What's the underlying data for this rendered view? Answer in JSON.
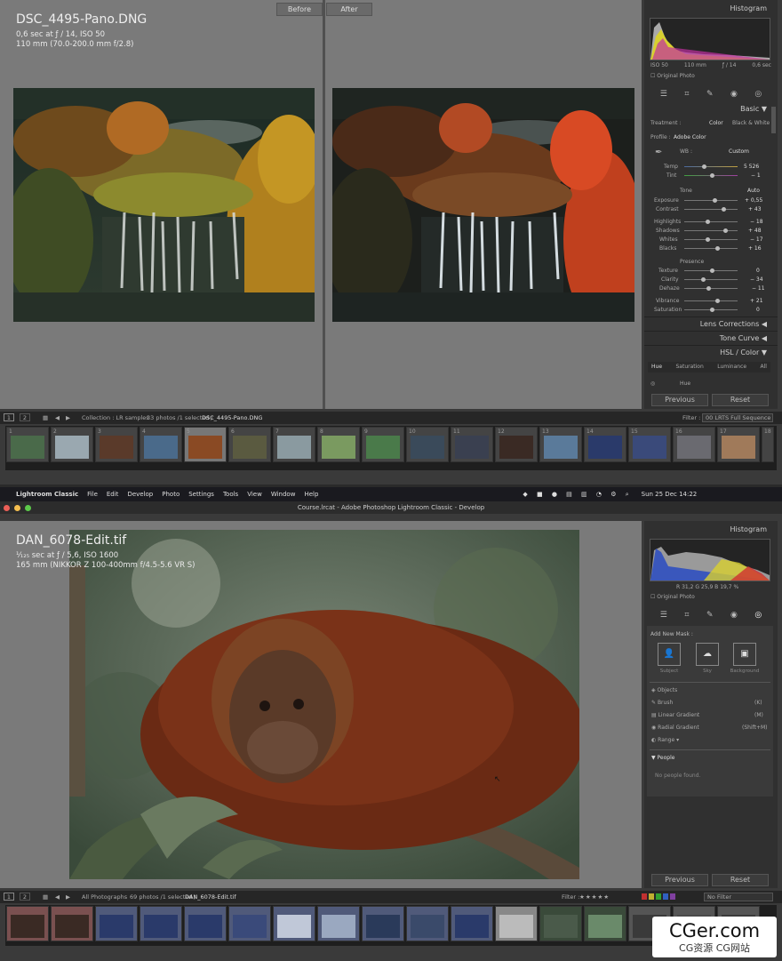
{
  "top": {
    "before_label": "Before",
    "after_label": "After",
    "filename": "DSC_4495-Pano.DNG",
    "meta_line1": "0,6 sec at ƒ / 14, ISO 50",
    "meta_line2": "110 mm (70.0-200.0 mm f/2.8)",
    "panel": {
      "histogram_title": "Histogram",
      "hist_info": [
        "ISO 50",
        "110 mm",
        "ƒ / 14",
        "0,6 sec"
      ],
      "original_photo": "Original Photo",
      "basic_title": "Basic",
      "treatment_label": "Treatment :",
      "color_label": "Color",
      "bw_label": "Black & White",
      "profile_label": "Profile :",
      "profile_value": "Adobe Color",
      "wb_label": "WB :",
      "wb_value": "Custom",
      "temp_label": "Temp",
      "temp_value": "5 526",
      "tint_label": "Tint",
      "tint_value": "− 1",
      "tone_label": "Tone",
      "auto_label": "Auto",
      "exposure_label": "Exposure",
      "exposure_value": "+ 0,55",
      "contrast_label": "Contrast",
      "contrast_value": "+ 43",
      "highlights_label": "Highlights",
      "highlights_value": "− 18",
      "shadows_label": "Shadows",
      "shadows_value": "+ 48",
      "whites_label": "Whites",
      "whites_value": "− 17",
      "blacks_label": "Blacks",
      "blacks_value": "+ 16",
      "presence_label": "Presence",
      "texture_label": "Texture",
      "texture_value": "0",
      "clarity_label": "Clarity",
      "clarity_value": "− 34",
      "dehaze_label": "Dehaze",
      "dehaze_value": "− 11",
      "vibrance_label": "Vibrance",
      "vibrance_value": "+ 21",
      "saturation_label": "Saturation",
      "saturation_value": "0",
      "lens_corrections": "Lens Corrections",
      "tone_curve": "Tone Curve",
      "hsl_color": "HSL / Color",
      "hsl_tabs": [
        "Hue",
        "Saturation",
        "Luminance",
        "All"
      ],
      "hue_label": "Hue",
      "previous": "Previous",
      "reset": "Reset"
    },
    "toolbar": {
      "page1": "1",
      "page2": "2",
      "collection": "Collection : LR samples",
      "count": "33 photos /1 selected /",
      "selected": "DSC_4495-Pano.DNG",
      "filter_label": "Filter :",
      "filter_value": "00 LRTS Full Sequence"
    },
    "filmstrip_numbers": [
      "1",
      "2",
      "3",
      "4",
      "5",
      "6",
      "7",
      "8",
      "9",
      "10",
      "11",
      "12",
      "13",
      "14",
      "15",
      "16",
      "17",
      "18"
    ]
  },
  "menubar": {
    "app": "Lightroom Classic",
    "items": [
      "File",
      "Edit",
      "Develop",
      "Photo",
      "Settings",
      "Tools",
      "View",
      "Window",
      "Help"
    ],
    "clock": "Sun 25 Dec  14:22"
  },
  "titlebar": "Course.lrcat - Adobe Photoshop Lightroom Classic - Develop",
  "bottom": {
    "filename": "DAN_6078-Edit.tif",
    "meta_line1": "¹⁄₁₂₅ sec at ƒ / 5,6, ISO 1600",
    "meta_line2": "165 mm (NIKKOR Z 100-400mm f/4.5-5.6 VR S)",
    "panel": {
      "histogram_title": "Histogram",
      "rgb_info": "R  31,2  G  25,9  B  19,7 %",
      "original_photo": "Original Photo",
      "add_new_mask": "Add New Mask :",
      "subject": "Subject",
      "sky": "Sky",
      "background": "Background",
      "objects": "Objects",
      "brush": "Brush",
      "brush_key": "(K)",
      "linear": "Linear Gradient",
      "linear_key": "(M)",
      "radial": "Radial Gradient",
      "radial_key": "(Shift+M)",
      "range": "Range",
      "people": "People",
      "no_people": "No people found.",
      "previous": "Previous",
      "reset": "Reset"
    },
    "toolbar": {
      "page1": "1",
      "page2": "2",
      "collection": "All Photographs",
      "count": "69 photos /1 selected /",
      "selected": "DAN_6078-Edit.tif",
      "filter_label": "Filter :",
      "filter_value": "No Filter"
    }
  },
  "watermark": {
    "line1": "CGer.com",
    "line2": "CG资源 CG网站"
  }
}
